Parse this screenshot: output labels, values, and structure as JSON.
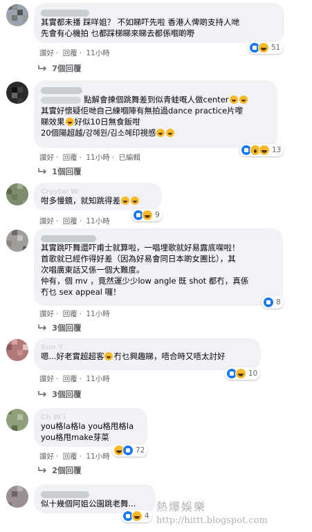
{
  "actions": {
    "like": "讚好",
    "reply": "回覆",
    "edited": "已編輯"
  },
  "comments": [
    {
      "lines": [
        "其實都未播 踩咩姐？ 不如睇吓先啦 香港人俾啲支持人哋",
        "先會有心機拍 乜都踩梯睇來睇去都係嗰啲嘢"
      ],
      "time": "11小時",
      "reactions": 51,
      "replies": "7個回覆"
    },
    {
      "lines": [
        "點解會揀個跳舞差到似青蛙嘅人做center",
        "其實好懷疑佢哋自己練嗰陣有無拍過dance practice片嚟",
        "睇效果",
        "好似10日無食飯咁",
        "20個陽超越/강혜원/김소혜印視感"
      ],
      "time": "11小時",
      "edited": true,
      "reactions": 13,
      "replies": "1個回覆"
    },
    {
      "author": "Crystal W",
      "lines": [
        "咁多慢鏡，就知跳得差"
      ],
      "time": "11小時",
      "reactions": 9
    },
    {
      "lines": [
        "其實跳吓舞還吓甫士就算啦，一唱埋歌就好易露底㗎啦！",
        "首歌就已經作得好差（因為好易會同日本啲女團比），其",
        "次唱廣東話又係一個大難度。",
        "仲有，個 mv ，竟然運少少low angle 既 shot 都冇，真係",
        "冇乜 sex appeal 囉！"
      ],
      "time": "11小時",
      "reactions": 8,
      "replies": "3個回覆"
    },
    {
      "author": "Sun Y",
      "lines": [
        "嗯...好老實超超客",
        "冇乜興趣睇，唔合時又唔太討好"
      ],
      "time": "11小時",
      "reactions": 10,
      "replies": "3個回覆"
    },
    {
      "author": "Ch   W    i",
      "lines": [
        "you格la格la you格甩格la",
        "you格甩make芽菜"
      ],
      "time": "11小時",
      "reactions": 72,
      "replies": "2個回覆"
    },
    {
      "lines": [
        "似十幾個阿姐公園跳老舞..."
      ],
      "reactions": 4
    }
  ],
  "watermark": {
    "title": "熱爆娛樂",
    "url": "http://hittt.blogspot.com"
  }
}
